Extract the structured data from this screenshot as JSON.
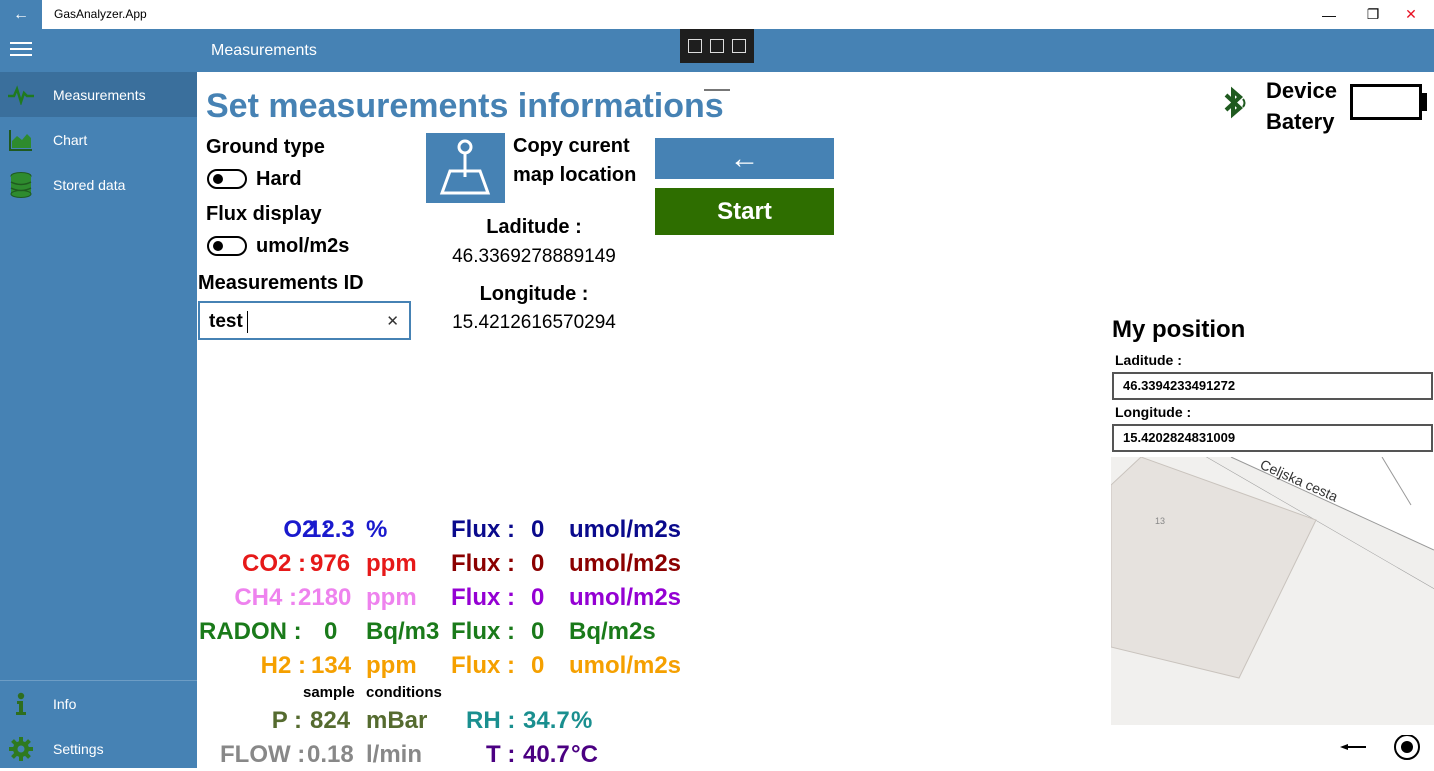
{
  "window": {
    "app_title": "GasAnalyzer.App",
    "minimize_glyph": "—",
    "maximize_glyph": "❐",
    "close_glyph": "✕",
    "back_glyph": "←"
  },
  "header": {
    "title": "Measurements"
  },
  "sidebar": {
    "items": [
      {
        "label": "Measurements",
        "icon": "pulse-icon"
      },
      {
        "label": "Chart",
        "icon": "area-chart-icon"
      },
      {
        "label": "Stored data",
        "icon": "database-icon"
      },
      {
        "label": "Info",
        "icon": "info-icon"
      },
      {
        "label": "Settings",
        "icon": "gear-icon"
      }
    ]
  },
  "main": {
    "title": "Set measurements informations",
    "ground_type_label": "Ground type",
    "ground_type_value": "Hard",
    "flux_display_label": "Flux display",
    "flux_display_value": "umol/m2s",
    "measurement_id_label": "Measurements ID",
    "measurement_id_value": "test",
    "clear_glyph": "✕",
    "copy_location_line1": "Copy curent",
    "copy_location_line2": "map location",
    "latitude_label": "Laditude :",
    "latitude_value": "46.3369278889149",
    "longitude_label": "Longitude :",
    "longitude_value": "15.4212616570294",
    "back_arrow_glyph": "←",
    "start_label": "Start"
  },
  "device": {
    "line1": "Device",
    "line2": "Batery"
  },
  "position": {
    "title": "My position",
    "latitude_label": "Laditude :",
    "latitude_value": "46.3394233491272",
    "longitude_label": "Longitude :",
    "longitude_value": "15.4202824831009",
    "map_street": "Celjska  cesta",
    "map_building": "13"
  },
  "readings": {
    "o2": {
      "label": "O2 :",
      "value": "12.3",
      "unit": "%",
      "flux_label": "Flux :",
      "flux_value": "0",
      "flux_unit": "umol/m2s"
    },
    "co2": {
      "label": "CO2 :",
      "value": "976",
      "unit": "ppm",
      "flux_label": "Flux :",
      "flux_value": "0",
      "flux_unit": "umol/m2s"
    },
    "ch4": {
      "label": "CH4 :",
      "value": "2180",
      "unit": "ppm",
      "flux_label": "Flux :",
      "flux_value": "0",
      "flux_unit": "umol/m2s"
    },
    "radon": {
      "label": "RADON :",
      "value": "0",
      "unit": "Bq/m3",
      "flux_label": "Flux :",
      "flux_value": "0",
      "flux_unit": "Bq/m2s"
    },
    "h2": {
      "label": "H2 :",
      "value": "134",
      "unit": "ppm",
      "flux_label": "Flux :",
      "flux_value": "0",
      "flux_unit": "umol/m2s"
    },
    "sample_label": "sample",
    "conditions_label": "conditions",
    "p": {
      "label": "P :",
      "value": "824",
      "unit": "mBar"
    },
    "rh": {
      "label": "RH :",
      "value": "34.7",
      "unit": "%"
    },
    "flow": {
      "label": "FLOW :",
      "value": "0.18",
      "unit": "l/min"
    },
    "t": {
      "label": "T :",
      "value": "40.7",
      "unit": "°C"
    }
  },
  "colors": {
    "accent": "#4682b4",
    "start": "#2e6e00",
    "o2": "#1a1acd",
    "co2": "#e61919",
    "ch4": "#ee82ee",
    "radon": "#1a7a1a",
    "h2": "#f5a000",
    "flux_o2": "#0a0a8c",
    "flux_co2": "#8b0000",
    "flux_ch4": "#9400d3",
    "p": "#556b2f",
    "rh": "#1a8f8f",
    "flow": "#888888",
    "t": "#4b0082"
  }
}
